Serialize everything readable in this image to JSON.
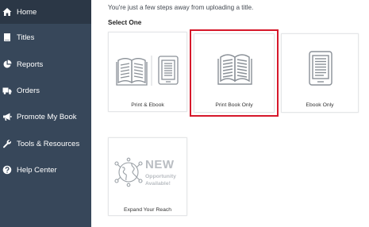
{
  "sidebar": {
    "items": [
      {
        "label": "Home",
        "icon": "home-icon",
        "active": true
      },
      {
        "label": "Titles",
        "icon": "book-icon",
        "active": false
      },
      {
        "label": "Reports",
        "icon": "pie-chart-icon",
        "active": false
      },
      {
        "label": "Orders",
        "icon": "truck-icon",
        "active": false
      },
      {
        "label": "Promote My Book",
        "icon": "megaphone-icon",
        "active": false
      },
      {
        "label": "Tools & Resources",
        "icon": "wrench-icon",
        "active": false
      },
      {
        "label": "Help Center",
        "icon": "question-icon",
        "active": false
      }
    ]
  },
  "main": {
    "intro": "You're just a few steps away from uploading a title.",
    "select_label": "Select One",
    "options": [
      {
        "label": "Print & Ebook",
        "icon": "print-and-ebook-icon",
        "selected": false
      },
      {
        "label": "Print Book Only",
        "icon": "open-book-icon",
        "selected": true
      },
      {
        "label": "Ebook Only",
        "icon": "ereader-icon",
        "selected": false
      }
    ],
    "promo": {
      "label": "Expand Your Reach",
      "badge": "NEW",
      "line1": "Opportunity",
      "line2": "Available!",
      "icon": "globe-icon"
    }
  },
  "colors": {
    "sidebar_bg": "#37475a",
    "sidebar_active_bg": "#2b3746",
    "highlight": "#d6182b",
    "icon_gray": "#8a9097"
  }
}
